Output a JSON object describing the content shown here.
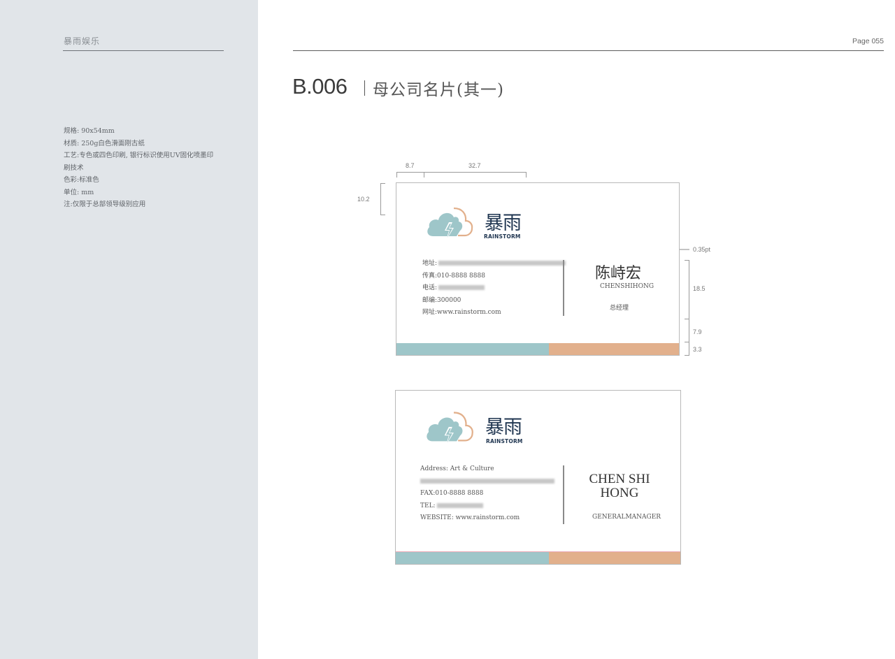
{
  "sidebar": {
    "brand": "暴雨娱乐",
    "specs": [
      "规格: 90x54mm",
      "材质: 250g白色滑面刚古纸",
      "工艺:专色或四色印刷, 银行标识使用UV固化喷墨印",
      "刷技术",
      "色彩:标准色",
      "单位: mm",
      "注:仅限于总部领导级别应用"
    ]
  },
  "header": {
    "page": "Page 055",
    "code": "B.006",
    "title": "母公司名片(其一)"
  },
  "logo": {
    "cn": "暴雨",
    "en": "RAINSTORM"
  },
  "colors": {
    "teal": "#9ec6c9",
    "peach": "#e2b08c",
    "navy": "#1f3550",
    "pink_line": "#e9a6b4"
  },
  "card_cn": {
    "address_label": "地址:",
    "fax_label": "传真:",
    "fax": "010-8888 8888",
    "phone_label": "电话:",
    "zip_label": "邮编:",
    "zip": "300000",
    "web_label": "网址:",
    "web": "www.rainstorm.com",
    "name": "陈峙宏",
    "name_pinyin": "CHENSHIHONG",
    "position": "总经理"
  },
  "card_en": {
    "address_label": "Address:",
    "address_line1": "Art & Culture",
    "fax": "FAX:010-8888 8888",
    "tel_label": "TEL:",
    "website": "WEBSITE: www.rainstorm.com",
    "name_line1": "CHEN SHI",
    "name_line2": "HONG",
    "position": "GENERALMANAGER"
  },
  "dimensions": {
    "left_margin": "8.7",
    "logo_width": "32.7",
    "top_margin": "10.2",
    "line_weight": "0.35pt",
    "right_block": "18.5",
    "bottom_gap": "7.9",
    "stripe": "3.3"
  }
}
